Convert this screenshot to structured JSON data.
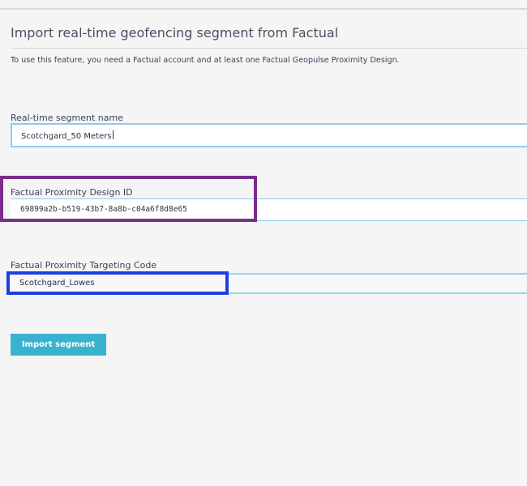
{
  "page": {
    "title": "Import real-time geofencing segment from Factual",
    "description": "To use this feature, you need a Factual account and at least one Factual Geopulse Proximity Design."
  },
  "form": {
    "segment_name": {
      "label": "Real-time segment name",
      "value": "Scotchgard_50 Meters"
    },
    "design_id": {
      "label": "Factual Proximity Design ID",
      "value": "69899a2b-b519-43b7-8a8b-c04a6f8d8e65"
    },
    "targeting_code": {
      "label": "Factual Proximity Targeting Code",
      "value": "Scotchgard_Lowes"
    }
  },
  "actions": {
    "import_label": "Import segment"
  },
  "colors": {
    "accent": "#38b3cf",
    "highlight_purple": "#7a2d8c",
    "highlight_blue": "#1f3ee0",
    "field_border": "#8fcbef"
  }
}
